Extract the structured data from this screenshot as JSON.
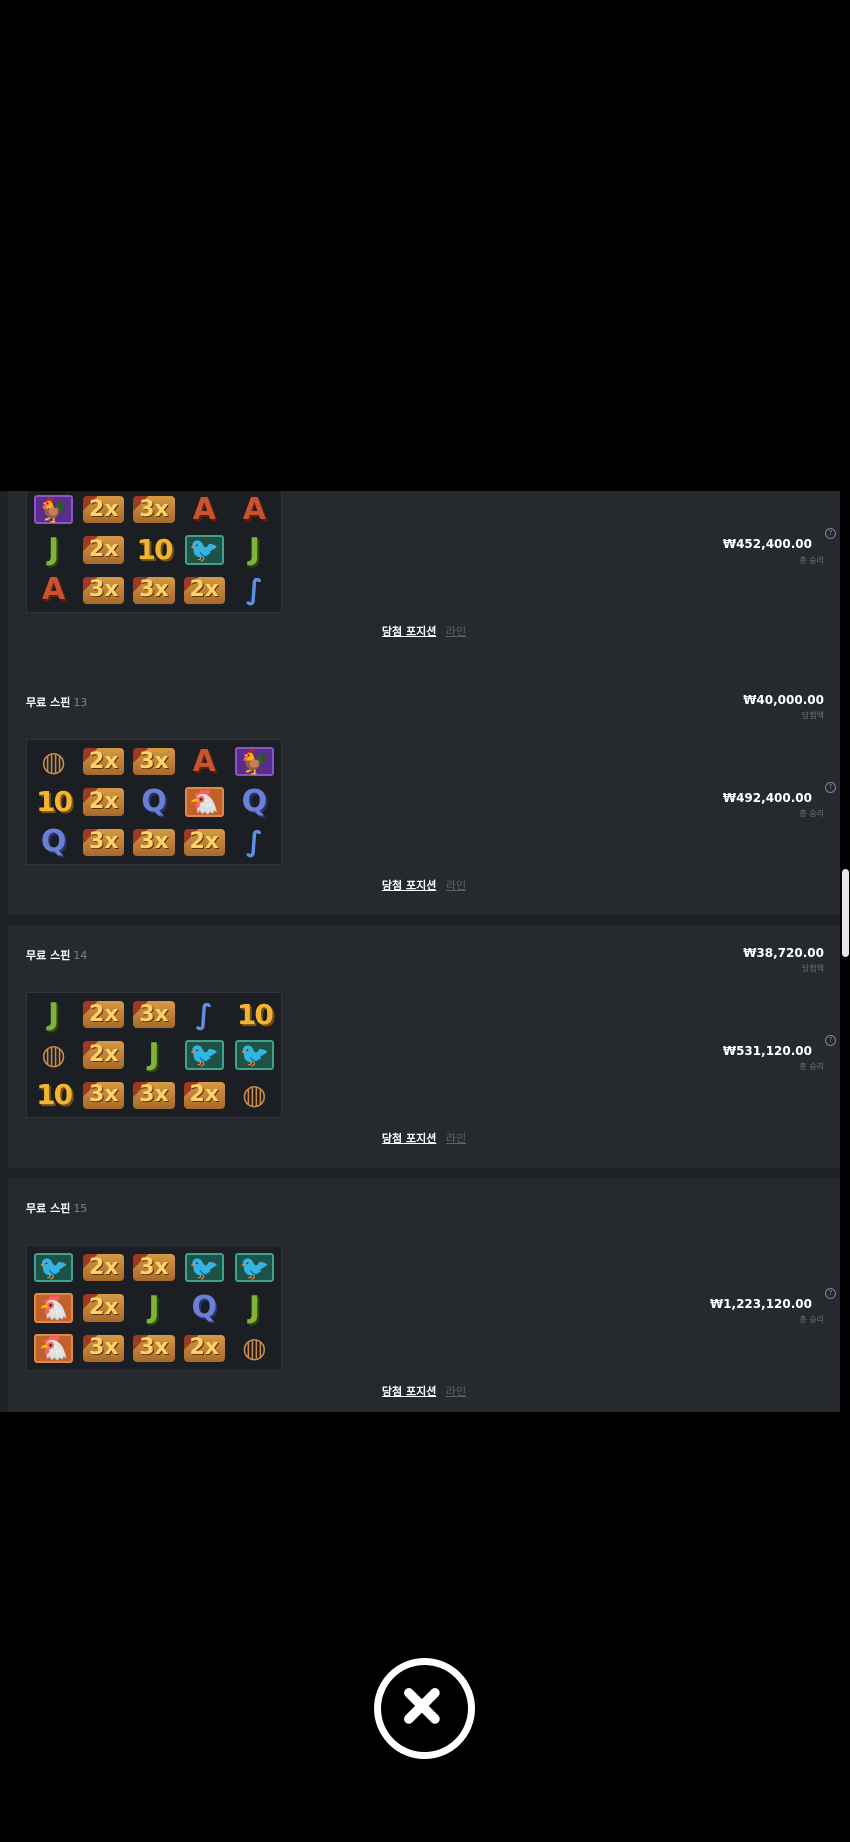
{
  "cards": [
    {
      "title": "",
      "number": "",
      "win_amount": "",
      "win_label": "",
      "total_amount": "₩452,400.00",
      "total_label": "총 승리",
      "help_glyph": "?",
      "link_positions": "당첨 포지션",
      "link_lines": "라인",
      "symbols": [
        [
          "rooster",
          "2x",
          "3x",
          "A",
          "A"
        ],
        [
          "J",
          "2x",
          "10",
          "greenbird",
          "J"
        ],
        [
          "A",
          "3x",
          "3x",
          "2x",
          "worm"
        ]
      ]
    },
    {
      "title": "무료 스핀",
      "number": "13",
      "win_amount": "₩40,000.00",
      "win_label": "당첨액",
      "total_amount": "₩492,400.00",
      "total_label": "총 승리",
      "help_glyph": "?",
      "link_positions": "당첨 포지션",
      "link_lines": "라인",
      "symbols": [
        [
          "nest",
          "2x",
          "3x",
          "A",
          "rooster"
        ],
        [
          "10",
          "2x",
          "Q",
          "chicken",
          "Q"
        ],
        [
          "Q",
          "3x",
          "3x",
          "2x",
          "worm"
        ]
      ]
    },
    {
      "title": "무료 스핀",
      "number": "14",
      "win_amount": "₩38,720.00",
      "win_label": "당첨액",
      "total_amount": "₩531,120.00",
      "total_label": "총 승리",
      "help_glyph": "?",
      "link_positions": "당첨 포지션",
      "link_lines": "라인",
      "symbols": [
        [
          "J",
          "2x",
          "3x",
          "worm",
          "10"
        ],
        [
          "nest",
          "2x",
          "J",
          "greenbird",
          "purplebird"
        ],
        [
          "10",
          "3x",
          "3x",
          "2x",
          "nest"
        ]
      ]
    },
    {
      "title": "무료 스핀",
      "number": "15",
      "win_amount": "",
      "win_label": "",
      "total_amount": "₩1,223,120.00",
      "total_label": "총 승리",
      "help_glyph": "?",
      "link_positions": "당첨 포지션",
      "link_lines": "라인",
      "symbols": [
        [
          "purplebird",
          "2x",
          "3x",
          "purplebird",
          "purplebird"
        ],
        [
          "chicken",
          "2x",
          "J",
          "Q",
          "J"
        ],
        [
          "chicken",
          "3x",
          "3x",
          "2x",
          "nest"
        ]
      ]
    }
  ],
  "symbol_glyphs": {
    "A": "A",
    "J": "J",
    "Q": "Q",
    "10": "10",
    "2x": "2x",
    "3x": "3x",
    "rooster": "🐓",
    "chicken": "🐔",
    "purplebird": "🐦",
    "greenbird": "🐦",
    "nest": "◍",
    "worm": "∫"
  },
  "close_icon": "close-icon"
}
